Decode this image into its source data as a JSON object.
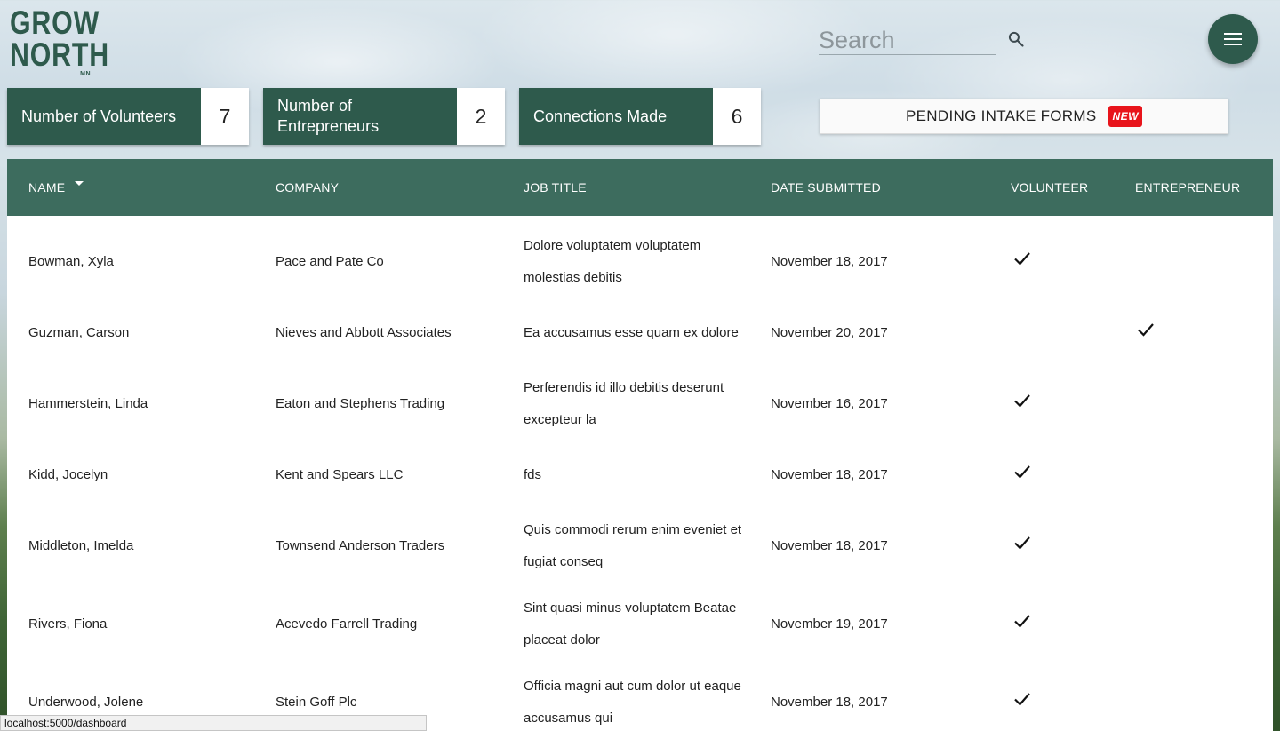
{
  "logo": {
    "line1": "GROW",
    "line2": "NORTH",
    "suffix": "MN"
  },
  "search": {
    "placeholder": "Search"
  },
  "icons": {
    "search": "search-icon",
    "menu": "menu-icon",
    "check": "check-icon",
    "sort": "sort-down-icon"
  },
  "colors": {
    "brand": "#2e5a4c",
    "header": "#3d6c5e",
    "badge": "#e8141b"
  },
  "stats": [
    {
      "label": "Number of Volunteers",
      "value": "7"
    },
    {
      "label": "Number of Entrepreneurs",
      "value": "2"
    },
    {
      "label": "Connections Made",
      "value": "6"
    }
  ],
  "pending": {
    "label": "PENDING INTAKE FORMS",
    "badge": "NEW"
  },
  "table": {
    "headers": {
      "name": "NAME",
      "company": "COMPANY",
      "job_title": "JOB TITLE",
      "date": "DATE SUBMITTED",
      "volunteer": "VOLUNTEER",
      "entrepreneur": "ENTREPRENEUR"
    },
    "sorted_by": "name",
    "rows": [
      {
        "name": "Bowman, Xyla",
        "company": "Pace and Pate Co",
        "job": "Dolore voluptatem voluptatem molestias debitis",
        "date": "November 18, 2017",
        "volunteer": true,
        "entrepreneur": false
      },
      {
        "name": "Guzman, Carson",
        "company": "Nieves and Abbott Associates",
        "job": "Ea accusamus esse quam ex dolore",
        "date": "November 20, 2017",
        "volunteer": false,
        "entrepreneur": true
      },
      {
        "name": "Hammerstein, Linda",
        "company": "Eaton and Stephens Trading",
        "job": "Perferendis id illo debitis deserunt excepteur la",
        "date": "November 16, 2017",
        "volunteer": true,
        "entrepreneur": false
      },
      {
        "name": "Kidd, Jocelyn",
        "company": "Kent and Spears LLC",
        "job": "fds",
        "date": "November 18, 2017",
        "volunteer": true,
        "entrepreneur": false
      },
      {
        "name": "Middleton, Imelda",
        "company": "Townsend Anderson Traders",
        "job": "Quis commodi rerum enim eveniet et fugiat conseq",
        "date": "November 18, 2017",
        "volunteer": true,
        "entrepreneur": false
      },
      {
        "name": "Rivers, Fiona",
        "company": "Acevedo Farrell Trading",
        "job": "Sint quasi minus voluptatem Beatae placeat dolor",
        "date": "November 19, 2017",
        "volunteer": true,
        "entrepreneur": false
      },
      {
        "name": "Underwood, Jolene",
        "company": "Stein Goff Plc",
        "job": "Officia magni aut cum dolor ut eaque accusamus qui",
        "date": "November 18, 2017",
        "volunteer": true,
        "entrepreneur": false
      }
    ]
  },
  "status_bar": {
    "url": "localhost:5000/dashboard"
  }
}
